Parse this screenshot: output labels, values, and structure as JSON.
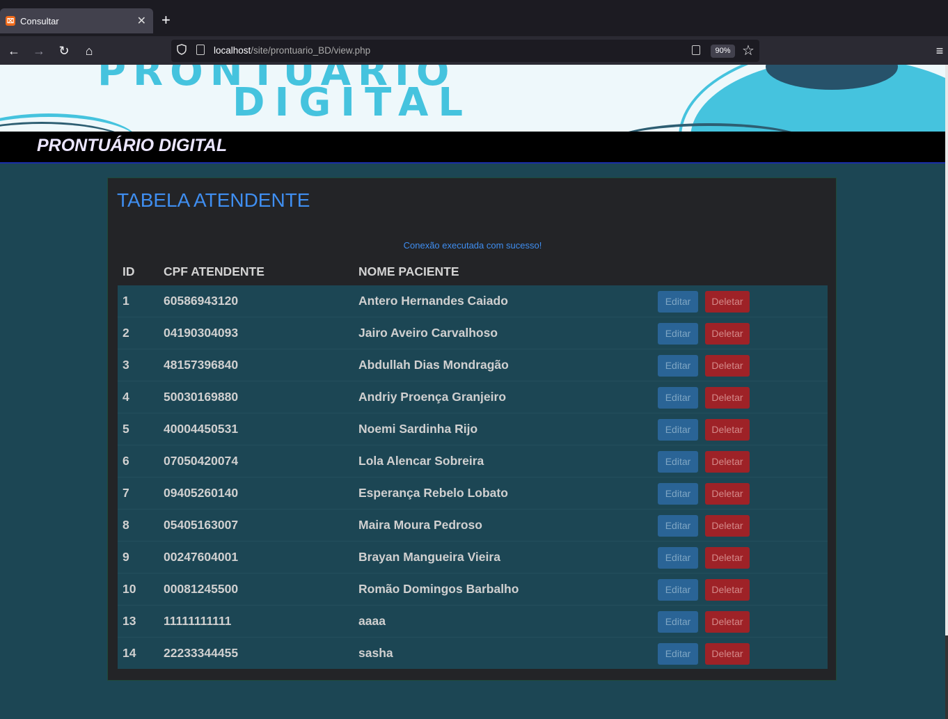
{
  "browser": {
    "tab_title": "Consultar",
    "tab_favicon": "xampp-icon",
    "url_host": "localhost",
    "url_path": "/site/prontuario_BD/view.php",
    "zoom": "90%"
  },
  "banner": {
    "line1": "PRONTUÁRIO",
    "line2": "DIGITAL"
  },
  "header": {
    "brand": "PRONTUÁRIO DIGITAL"
  },
  "main": {
    "heading": "TABELA ATENDENTE",
    "status": "Conexão executada com sucesso!",
    "columns": [
      "ID",
      "CPF ATENDENTE",
      "NOME PACIENTE"
    ],
    "edit_label": "Editar",
    "delete_label": "Deletar",
    "rows": [
      {
        "id": "1",
        "cpf": "60586943120",
        "nome": "Antero Hernandes Caiado"
      },
      {
        "id": "2",
        "cpf": "04190304093",
        "nome": "Jairo Aveiro Carvalhoso"
      },
      {
        "id": "3",
        "cpf": "48157396840",
        "nome": "Abdullah Dias Mondragão"
      },
      {
        "id": "4",
        "cpf": "50030169880",
        "nome": "Andriy Proença Granjeiro"
      },
      {
        "id": "5",
        "cpf": "40004450531",
        "nome": "Noemi Sardinha Rijo"
      },
      {
        "id": "6",
        "cpf": "07050420074",
        "nome": "Lola Alencar Sobreira"
      },
      {
        "id": "7",
        "cpf": "09405260140",
        "nome": "Esperança Rebelo Lobato"
      },
      {
        "id": "8",
        "cpf": "05405163007",
        "nome": "Maira Moura Pedroso"
      },
      {
        "id": "9",
        "cpf": "00247604001",
        "nome": "Brayan Mangueira Vieira"
      },
      {
        "id": "10",
        "cpf": "00081245500",
        "nome": "Romão Domingos Barbalho"
      },
      {
        "id": "13",
        "cpf": "11111111111",
        "nome": "aaaa"
      },
      {
        "id": "14",
        "cpf": "22233344455",
        "nome": "sasha"
      }
    ]
  },
  "colors": {
    "page_bg": "#1c4654",
    "card_bg": "#232427",
    "accent_blue": "#3f8ef0",
    "edit_btn": "#2a6496",
    "delete_btn": "#9e2227",
    "banner_cyan": "#45c3de"
  }
}
